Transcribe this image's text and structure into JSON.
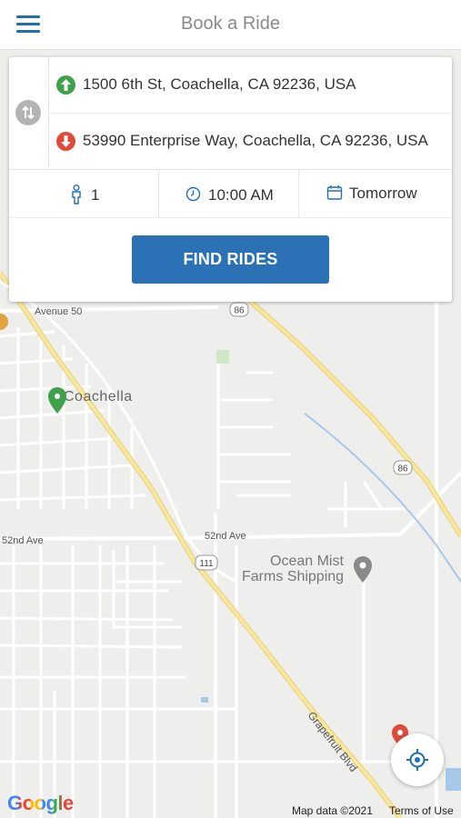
{
  "header": {
    "title": "Book a Ride"
  },
  "route": {
    "pickup": "1500 6th St, Coachella, CA 92236, USA",
    "dropoff": "53990 Enterprise Way, Coachella, CA 92236, USA"
  },
  "options": {
    "passengers": "1",
    "time": "10:00 AM",
    "date": "Tomorrow"
  },
  "actions": {
    "find_rides": "FIND RIDES"
  },
  "map": {
    "labels": {
      "avenue50": "Avenue 50",
      "hwy86": "86",
      "coachella": "Coachella",
      "nd52_left": "52nd Ave",
      "nd52_mid": "52nd Ave",
      "hwy111": "111",
      "ocean_mist_line1": "Ocean Mist",
      "ocean_mist_line2": "Farms Shipping",
      "grapefruit": "Grapefruit Blvd"
    },
    "google_logo": "Google",
    "attribution": "Map data ©2021",
    "terms": "Terms of Use"
  },
  "colors": {
    "accent": "#2a72b5",
    "pickup": "#3fa14a",
    "dropoff": "#e04a3a",
    "icon": "#1f6fb3"
  },
  "icons": [
    "menu-icon",
    "swap-icon",
    "pickup-arrow-icon",
    "dropoff-arrow-icon",
    "person-icon",
    "clock-icon",
    "calendar-icon",
    "locate-icon",
    "place-pin-icon"
  ]
}
